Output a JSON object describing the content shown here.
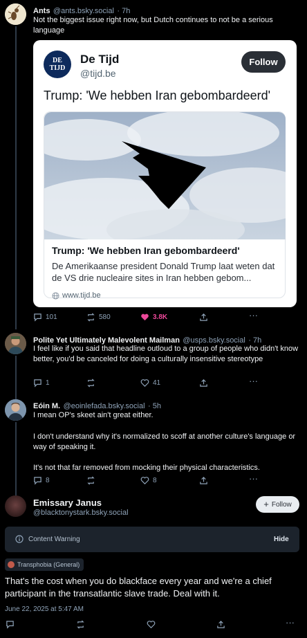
{
  "post1": {
    "author_name": "Ants",
    "author_handle": "@ants.bsky.social",
    "time": "· 7h",
    "text": "Not the biggest issue right now, but Dutch continues to not be a serious language",
    "embed": {
      "publisher_logo_text_top": "DE",
      "publisher_logo_text_bottom": "TIJD",
      "publisher_name": "De Tijd",
      "publisher_handle": "@tijd.be",
      "follow_label": "Follow",
      "headline": "Trump: 'We hebben Iran gebombardeerd'",
      "link_title": "Trump: 'We hebben Iran gebombardeerd'",
      "link_description": "De Amerikaanse president Donald Trump laat weten dat de VS drie nucleaire sites in Iran hebben gebom...",
      "link_domain": "www.tijd.be"
    },
    "replies": "101",
    "reposts": "580",
    "likes": "3.8K",
    "like_color": "#ec4899"
  },
  "post2": {
    "author_name": "Polite Yet Ultimately Malevolent Mailman",
    "author_handle": "@usps.bsky.social",
    "time": "· 7h",
    "text": "I feel like if you said that headline outloud to a group of people who didn't know better, you'd be canceled for doing a culturally insensitive stereotype",
    "replies": "1",
    "reposts": "",
    "likes": "41"
  },
  "post3": {
    "author_name": "Eóin M.",
    "author_handle": "@eoinlefada.bsky.social",
    "time": "· 5h",
    "para1": "I mean OP's skeet ain't great either.",
    "para2": "I don't understand why it's normalized to scoff at another culture's language or way of speaking it.",
    "para3": "It's not that far removed from mocking their physical characteristics.",
    "replies": "8",
    "reposts": "",
    "likes": "8"
  },
  "post4": {
    "author_name": "Emissary Janus",
    "author_handle": "@blacktonystark.bsky.social",
    "follow_label": "Follow",
    "content_warning_label": "Content Warning",
    "hide_label": "Hide",
    "label_badge": "Transphobia (General)",
    "text": "That's the cost when you do blackface every year and we're a chief participant in the transatlantic slave trade. Deal with it.",
    "timestamp": "June 22, 2025 at 5:47 AM"
  }
}
